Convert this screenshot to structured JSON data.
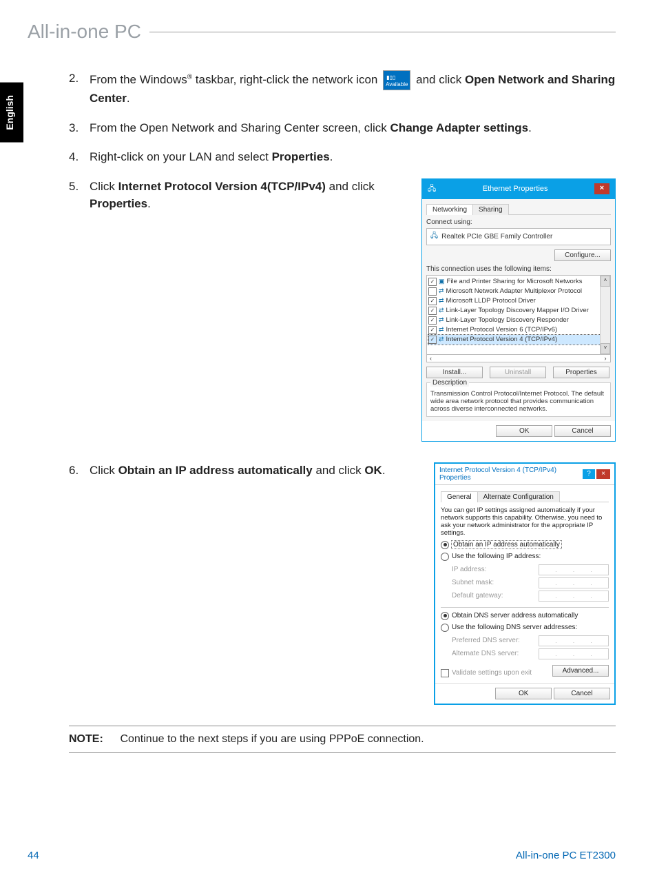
{
  "header": {
    "title": "All-in-one PC"
  },
  "sidetab": {
    "label": "English"
  },
  "steps": {
    "s2": {
      "num": "2.",
      "a": "From the Windows",
      "reg": "®",
      "b": " taskbar, right-click the network icon ",
      "c": " and click ",
      "bold1": "Open Network and Sharing Center",
      "d": "."
    },
    "s3": {
      "num": "3.",
      "a": "From the Open Network and Sharing Center screen, click ",
      "bold1": "Change Adapter settings",
      "b": "."
    },
    "s4": {
      "num": "4.",
      "a": "Right-click on your LAN and select ",
      "bold1": "Properties",
      "b": "."
    },
    "s5": {
      "num": "5.",
      "a": "Click ",
      "bold1": "Internet Protocol Version 4(TCP/IPv4)",
      "b": " and click ",
      "bold2": "Properties",
      "c": "."
    },
    "s6": {
      "num": "6.",
      "a": "Click ",
      "bold1": "Obtain an IP address automatically",
      "b": " and click ",
      "bold2": "OK",
      "c": "."
    }
  },
  "icon": {
    "label": "Available"
  },
  "dlg1": {
    "title": "Ethernet Properties",
    "tab1": "Networking",
    "tab2": "Sharing",
    "connect_label": "Connect using:",
    "adapter": "Realtek PCIe GBE Family Controller",
    "configure": "Configure...",
    "uses_label": "This connection uses the following items:",
    "items": [
      {
        "checked": "☑",
        "text": "File and Printer Sharing for Microsoft Networks"
      },
      {
        "checked": "☐",
        "text": "Microsoft Network Adapter Multiplexor Protocol"
      },
      {
        "checked": "☑",
        "text": "Microsoft LLDP Protocol Driver"
      },
      {
        "checked": "☑",
        "text": "Link-Layer Topology Discovery Mapper I/O Driver"
      },
      {
        "checked": "☑",
        "text": "Link-Layer Topology Discovery Responder"
      },
      {
        "checked": "☑",
        "text": "Internet Protocol Version 6 (TCP/IPv6)"
      },
      {
        "checked": "☑",
        "text": "Internet Protocol Version 4 (TCP/IPv4)",
        "selected": true
      }
    ],
    "install": "Install...",
    "uninstall": "Uninstall",
    "properties": "Properties",
    "desc_label": "Description",
    "desc_text": "Transmission Control Protocol/Internet Protocol. The default wide area network protocol that provides communication across diverse interconnected networks.",
    "ok": "OK",
    "cancel": "Cancel"
  },
  "dlg2": {
    "title": "Internet Protocol Version 4 (TCP/IPv4) Properties",
    "tab1": "General",
    "tab2": "Alternate Configuration",
    "intro": "You can get IP settings assigned automatically if your network supports this capability. Otherwise, you need to ask your network administrator for the appropriate IP settings.",
    "r1": "Obtain an IP address automatically",
    "r2": "Use the following IP address:",
    "ip": "IP address:",
    "mask": "Subnet mask:",
    "gw": "Default gateway:",
    "r3": "Obtain DNS server address automatically",
    "r4": "Use the following DNS server addresses:",
    "dns1": "Preferred DNS server:",
    "dns2": "Alternate DNS server:",
    "validate": "Validate settings upon exit",
    "advanced": "Advanced...",
    "ok": "OK",
    "cancel": "Cancel"
  },
  "note": {
    "label": "NOTE:",
    "text": "Continue to the next steps if you are using PPPoE connection."
  },
  "footer": {
    "page": "44",
    "model": "All-in-one PC ET2300"
  }
}
